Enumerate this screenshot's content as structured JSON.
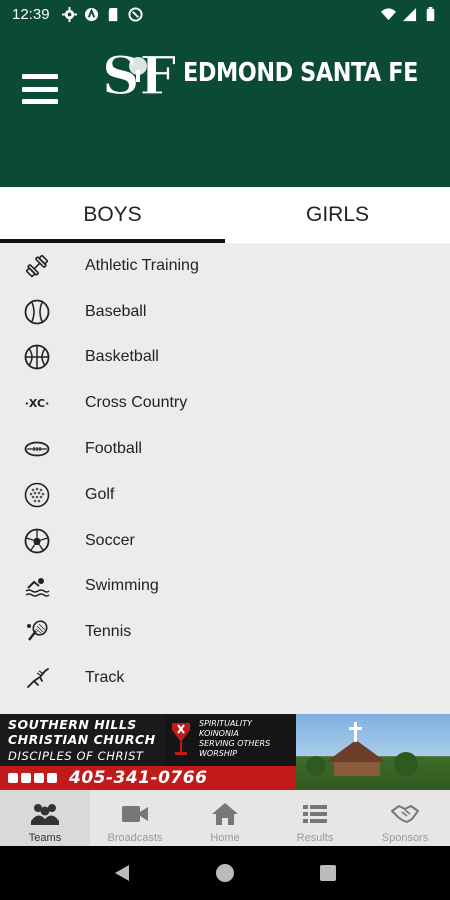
{
  "status_bar": {
    "time": "12:39"
  },
  "header": {
    "title": "EDMOND SANTA FE",
    "logo_text": "SF"
  },
  "tabs": [
    {
      "label": "BOYS",
      "active": true
    },
    {
      "label": "GIRLS",
      "active": false
    }
  ],
  "sports": [
    {
      "label": "Athletic Training",
      "icon": "dumbbell-icon"
    },
    {
      "label": "Baseball",
      "icon": "baseball-icon"
    },
    {
      "label": "Basketball",
      "icon": "basketball-icon"
    },
    {
      "label": "Cross Country",
      "icon": "cross-country-icon",
      "icon_text": "·XC·"
    },
    {
      "label": "Football",
      "icon": "football-icon"
    },
    {
      "label": "Golf",
      "icon": "golf-ball-icon"
    },
    {
      "label": "Soccer",
      "icon": "soccer-ball-icon"
    },
    {
      "label": "Swimming",
      "icon": "swimmer-icon"
    },
    {
      "label": "Tennis",
      "icon": "tennis-racket-icon"
    },
    {
      "label": "Track",
      "icon": "track-runner-icon"
    }
  ],
  "banner_ad": {
    "name_line1": "SOUTHERN HILLS",
    "name_line2": "CHRISTIAN CHURCH",
    "subtitle": "DISCIPLES OF CHRIST",
    "values": [
      "SPIRITUALITY",
      "KOINONIA",
      "SERVING OTHERS",
      "WORSHIP"
    ],
    "phone": "405-341-0766"
  },
  "bottom_nav": [
    {
      "label": "Teams",
      "icon": "teams-icon",
      "active": true
    },
    {
      "label": "Broadcasts",
      "icon": "video-camera-icon",
      "active": false
    },
    {
      "label": "Home",
      "icon": "home-icon",
      "active": false
    },
    {
      "label": "Results",
      "icon": "list-icon",
      "active": false
    },
    {
      "label": "Sponsors",
      "icon": "handshake-icon",
      "active": false
    }
  ],
  "colors": {
    "brand": "#0c4a38",
    "ad_red": "#c11a1a",
    "list_bg": "#ececec"
  }
}
